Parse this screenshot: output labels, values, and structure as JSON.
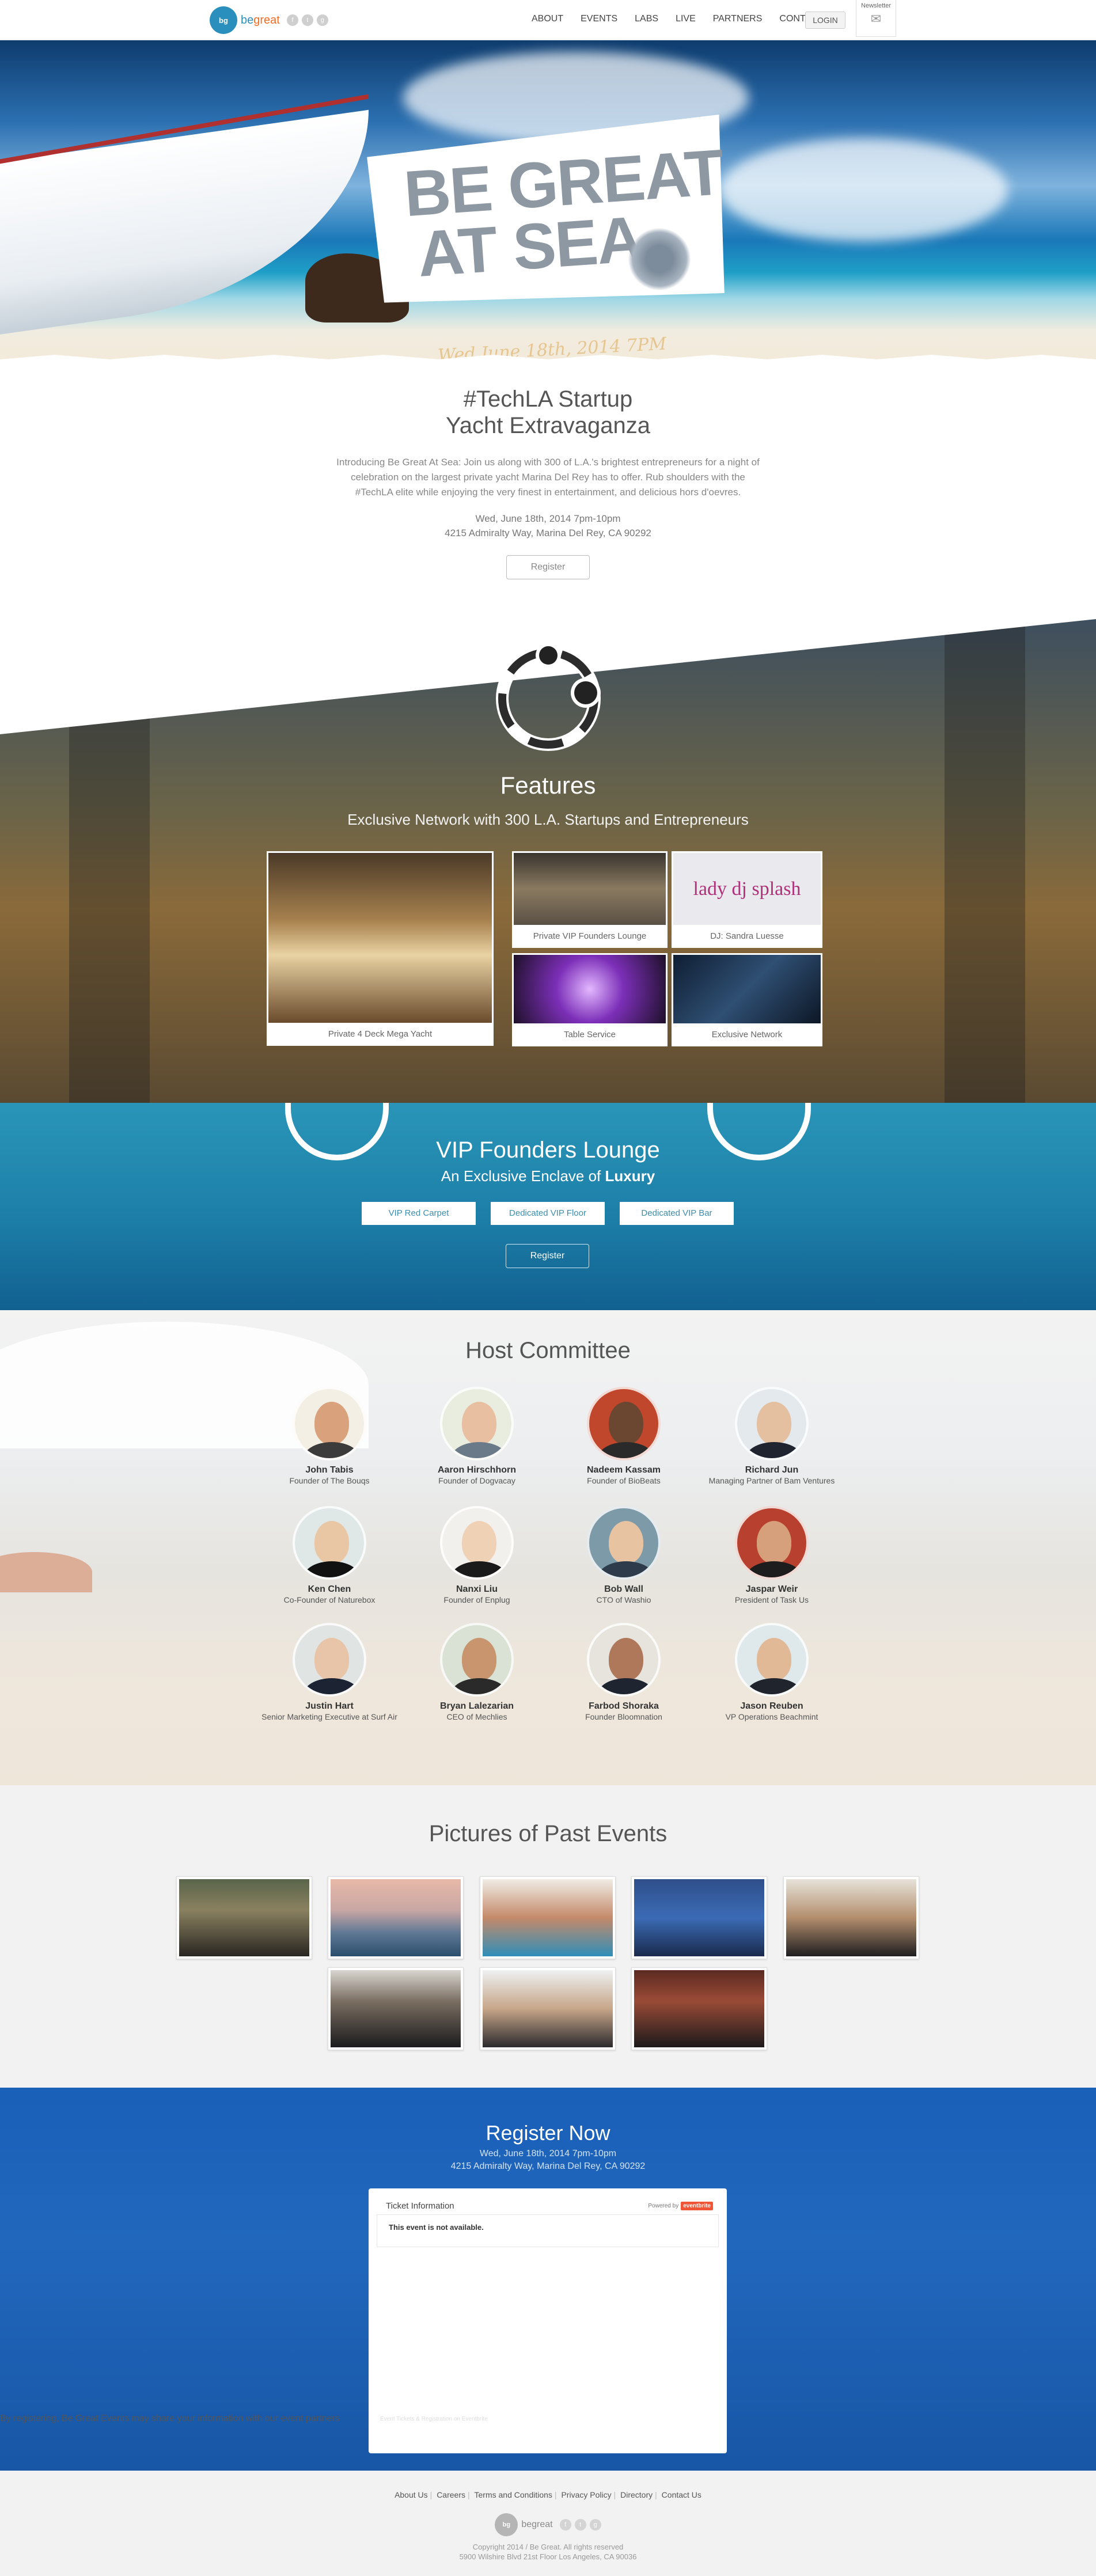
{
  "nav": {
    "logo_text": "be",
    "logo_accent": "great",
    "logo_mark": "bg",
    "social": [
      "f",
      "t",
      "g"
    ],
    "menu": [
      "ABOUT",
      "EVENTS",
      "LABS",
      "LIVE",
      "PARTNERS",
      "CONTACT"
    ],
    "login": "LOGIN",
    "newsletter": "Newsletter"
  },
  "hero": {
    "title_line1": "BE GREAT",
    "title_line2": "AT SEA",
    "date": "Wed June 18th, 2014 7PM"
  },
  "intro": {
    "title_line1": "#TechLA Startup",
    "title_line2": "Yacht Extravaganza",
    "lead": "Introducing Be Great At Sea: Join us along with 300 of L.A.'s brightest entrepreneurs for a night of celebration on the largest private yacht Marina Del Rey has to offer. Rub shoulders with the #TechLA elite while enjoying the very finest in entertainment, and delicious hors d'oevres.",
    "date": "Wed, June 18th, 2014 7pm-10pm",
    "address": "4215 Admiralty Way, Marina Del Rey, CA 90292",
    "register": "Register"
  },
  "features": {
    "title": "Features",
    "subtitle": "Exclusive Network with 300 L.A. Startups and Entrepreneurs",
    "cards": [
      {
        "caption": "Private 4 Deck Mega Yacht"
      },
      {
        "caption": "Private VIP Founders Lounge"
      },
      {
        "caption": "DJ: Sandra Luesse"
      },
      {
        "caption": "Table Service"
      },
      {
        "caption": "Exclusive Network"
      }
    ],
    "dj_logo_text": "lady dj splash"
  },
  "vip": {
    "title": "VIP Founders Lounge",
    "subtitle_pre": "An Exclusive Enclave of",
    "subtitle_bold": "Luxury",
    "pills": [
      "VIP Red Carpet",
      "Dedicated VIP Floor",
      "Dedicated VIP Bar"
    ],
    "register": "Register"
  },
  "host": {
    "title": "Host Committee",
    "members": [
      {
        "name": "John Tabis",
        "role": "Founder of The Bouqs"
      },
      {
        "name": "Aaron Hirschhorn",
        "role": "Founder of Dogvacay"
      },
      {
        "name": "Nadeem Kassam",
        "role": "Founder of BioBeats"
      },
      {
        "name": "Richard Jun",
        "role": "Managing Partner of Bam Ventures"
      },
      {
        "name": "Ken Chen",
        "role": "Co-Founder of Naturebox"
      },
      {
        "name": "Nanxi Liu",
        "role": "Founder of Enplug"
      },
      {
        "name": "Bob Wall",
        "role": "CTO of Washio"
      },
      {
        "name": "Jaspar Weir",
        "role": "President of Task Us"
      },
      {
        "name": "Justin Hart",
        "role": "Senior Marketing Executive at Surf Air"
      },
      {
        "name": "Bryan Lalezarian",
        "role": "CEO of Mechlies"
      },
      {
        "name": "Farbod Shoraka",
        "role": "Founder Bloomnation"
      },
      {
        "name": "Jason Reuben",
        "role": "VP Operations Beachmint"
      }
    ]
  },
  "past": {
    "title": "Pictures of Past Events"
  },
  "register": {
    "title": "Register Now",
    "date": "Wed, June 18th, 2014 7pm-10pm",
    "address": "4215 Admiralty Way, Marina Del Rey, CA 90292",
    "ticket_title": "Ticket Information",
    "powered": "Powered by",
    "eventbrite": "eventbrite",
    "message": "This event is not available.",
    "fine_print": "Event Tickets & Registration on Eventbrite",
    "disclaimer": "By registering, Be Great Events may share your information with our event partners"
  },
  "footer": {
    "links": [
      "About Us",
      "Careers",
      "Terms and Conditions",
      "Privacy Policy",
      "Directory",
      "Contact Us"
    ],
    "logo_text": "begreat",
    "copyright": "Copyright 2014 / Be Great. All rights reserved",
    "address": "5900 Wilshire Blvd 21st Floor Los Angeles, CA 90036"
  },
  "colors": {
    "brand_blue": "#2a8fbd",
    "brand_orange": "#f26b21",
    "vip_teal": "#1d7fa8",
    "register_blue": "#1a5fb8"
  }
}
